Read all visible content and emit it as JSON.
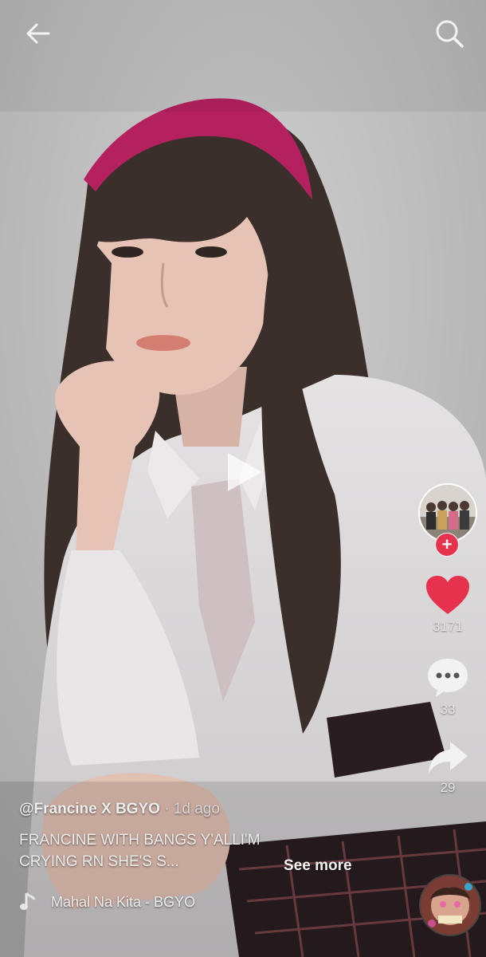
{
  "author": {
    "handle": "@Francine X BGYO",
    "separator": "·",
    "time": "1d ago"
  },
  "caption": {
    "text": "FRANCINE WITH BANGS Y'ALLI'M CRYING RN SHE'S S...",
    "see_more": "See more"
  },
  "music": {
    "title": "Mahal Na Kita - BGYO"
  },
  "actions": {
    "follow_symbol": "+",
    "likes": "3171",
    "comments": "33",
    "shares": "29"
  },
  "icons": {
    "back": "back-arrow-icon",
    "search": "search-icon",
    "play": "play-icon",
    "like": "heart-icon",
    "comment": "comment-bubble-icon",
    "share": "share-arrow-icon",
    "music": "music-note-icon"
  },
  "colors": {
    "like": "#e7324d",
    "follow": "#e7324d",
    "headband": "#b5215f"
  }
}
